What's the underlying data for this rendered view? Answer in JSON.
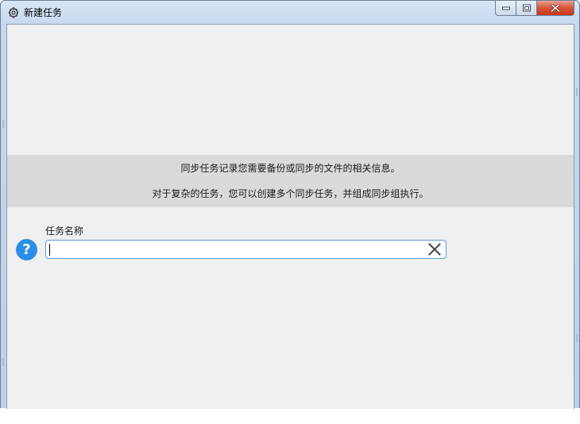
{
  "window": {
    "title": "新建任务",
    "icon": "gear-app-icon"
  },
  "caption": {
    "minimize_icon": "minimize-icon",
    "maximize_icon": "maximize-icon",
    "close_icon": "close-icon"
  },
  "info": {
    "line1": "同步任务记录您需要备份或同步的文件的相关信息。",
    "line2": "对于复杂的任务，您可以创建多个同步任务，并组成同步组执行。"
  },
  "form": {
    "help_icon": "help-icon",
    "help_glyph": "?",
    "task_name_label": "任务名称",
    "task_name_value": "",
    "clear_icon": "clear-x-icon"
  },
  "colors": {
    "help_blue": "#2b8ee6",
    "input_border": "#5a9bd8",
    "band": "#dadada",
    "client_bg": "#f0f0f0",
    "close_red": "#c7381b"
  }
}
